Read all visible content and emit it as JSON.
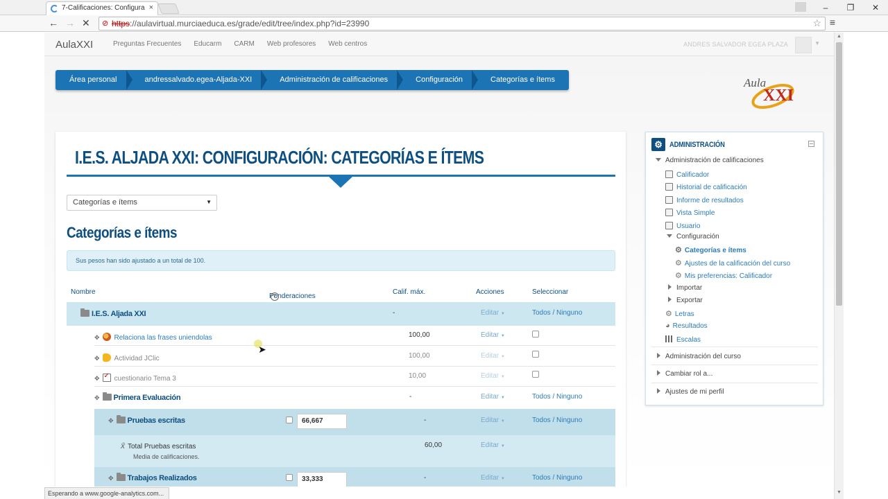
{
  "browser": {
    "tab_title": "7-Calificaciones: Configura",
    "tab_close": "×",
    "url_scheme": "https",
    "url_rest": "://aulavirtual.murciaeduca.es/grade/edit/tree/index.php?id=23990",
    "status": "Esperando a www.google-analytics.com..."
  },
  "navbar": {
    "brand": "AulaXXI",
    "links": [
      "Preguntas Frecuentes",
      "Educarm",
      "CARM",
      "Web profesores",
      "Web centros"
    ],
    "username": "ANDRES SALVADOR EGEA PLAZA"
  },
  "breadcrumb": [
    "Área personal",
    "andressalvado.egea-Aljada-XXI",
    "Administración de calificaciones",
    "Configuración",
    "Categorías e ítems"
  ],
  "logo": {
    "text_top": "Aula",
    "text_bottom": "XXI"
  },
  "main": {
    "heading": "I.E.S. ALJADA XXI: CONFIGURACIÓN: CATEGORÍAS E ÍTEMS",
    "select_value": "Categorías e ítems",
    "subheading": "Categorías e ítems",
    "notice": "Sus pesos han sido ajustado a un total de 100.",
    "columns": {
      "name": "Nombre",
      "weights": "Ponderaciones",
      "help": "?",
      "max": "Calif. máx.",
      "actions": "Acciones",
      "select": "Seleccionar"
    },
    "edit_label": "Editar",
    "all_label": "Todos",
    "none_label": "Ninguno",
    "slash": "/",
    "rows": [
      {
        "type": "category",
        "name": "I.E.S. Aljada XXI",
        "max": "-"
      },
      {
        "type": "item",
        "name": "Relaciona las frases uniendolas",
        "max": "100,00",
        "icon": "relaciona-icon"
      },
      {
        "type": "item",
        "name": "Actividad JClic",
        "max": "100,00",
        "icon": "jclic-icon"
      },
      {
        "type": "item",
        "name": "cuestionario Tema 3",
        "max": "10,00",
        "icon": "quiz-icon"
      },
      {
        "type": "category",
        "name": "Primera Evaluación",
        "max": "-"
      },
      {
        "type": "subcategory",
        "name": "Pruebas escritas",
        "weight": "66,667",
        "max": "-"
      },
      {
        "type": "total",
        "name": "Total Pruebas escritas",
        "sub": "Media de calificaciones.",
        "max": "60,00"
      },
      {
        "type": "subcategory",
        "name": "Trabajos Realizados",
        "weight": "33,333",
        "max": "-"
      }
    ]
  },
  "admin_block": {
    "title": "ADMINISTRACIÓN",
    "grades_admin": "Administración de calificaciones",
    "items": [
      "Calificador",
      "Historial de calificación",
      "Informe de resultados",
      "Vista Simple",
      "Usuario"
    ],
    "config": "Configuración",
    "config_items": [
      "Categorías e ítems",
      "Ajustes de la calificación del curso",
      "Mis preferencias: Calificador"
    ],
    "import": "Importar",
    "export": "Exportar",
    "letters": "Letras",
    "outcomes": "Resultados",
    "scales": "Escalas",
    "course_admin": "Administración del curso",
    "switch_role": "Cambiar rol a...",
    "profile_settings": "Ajustes de mi perfil"
  }
}
